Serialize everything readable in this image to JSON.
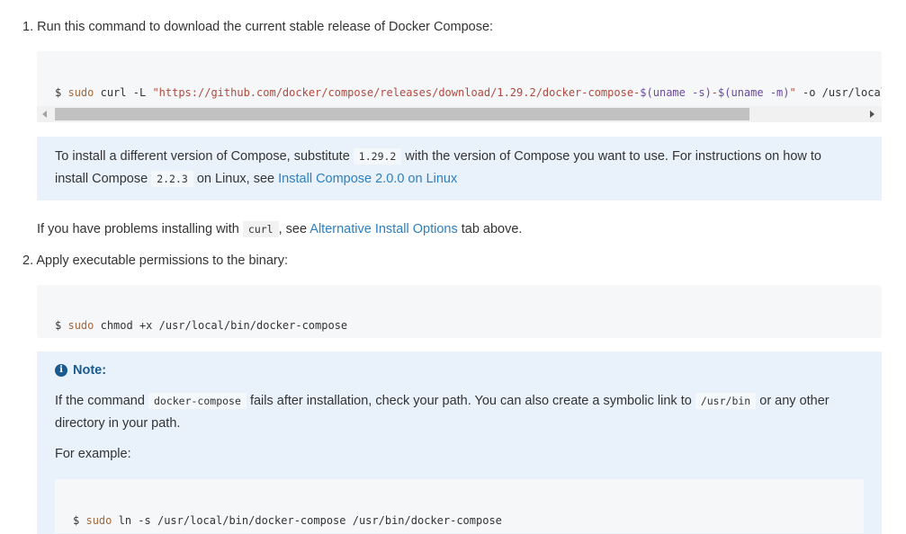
{
  "step1": {
    "number": "1.",
    "text": "Run this command to download the current stable release of Docker Compose:",
    "command": {
      "prompt": "$",
      "sudo": "sudo",
      "cmd": "curl",
      "flag_L": "-L",
      "url_start": "\"https://github.com/docker/compose/releases/download/1.29.2/docker-compose-",
      "uname_s": "$(uname -s)",
      "dash": "-",
      "uname_m": "$(uname -m)",
      "url_end": "\"",
      "flag_o": "-o",
      "dest": "/usr/local/"
    }
  },
  "version_note": {
    "part1": "To install a different version of Compose, substitute",
    "version_code": "1.29.2",
    "part2": "with the version of Compose you want to use. For instructions on how to install Compose",
    "version2_code": "2.2.3",
    "part3": "on Linux, see",
    "link": "Install Compose 2.0.0 on Linux"
  },
  "curl_problem": {
    "part1": "If you have problems installing with",
    "code": "curl",
    "part2": ", see",
    "link": "Alternative Install Options",
    "part3": "tab above."
  },
  "step2": {
    "number": "2.",
    "text": "Apply executable permissions to the binary:",
    "command": {
      "prompt": "$",
      "sudo": "sudo",
      "rest": "chmod +x /usr/local/bin/docker-compose"
    }
  },
  "note": {
    "icon": "info-icon",
    "title": "Note:",
    "p1_part1": "If the command",
    "p1_code1": "docker-compose",
    "p1_part2": "fails after installation, check your path. You can also create a symbolic link to",
    "p1_code2": "/usr/bin",
    "p1_part3": "or any other directory in your path.",
    "p2": "For example:",
    "command": {
      "prompt": "$",
      "sudo": "sudo",
      "cmd": "ln",
      "flag": "-s",
      "rest": "/usr/local/bin/docker-compose /usr/bin/docker-compose"
    }
  },
  "colors": {
    "link": "#2d7fc1",
    "note_bg": "#e9f2fb",
    "code_bg": "#f6f7f8"
  }
}
